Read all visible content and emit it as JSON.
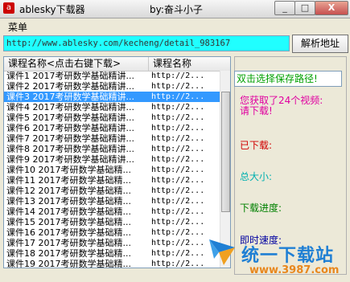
{
  "window": {
    "title": "ablesky下载器",
    "author": "by:奋斗小子",
    "min_glyph": "_",
    "max_glyph": "□",
    "close_glyph": "X"
  },
  "menu": {
    "label": "菜单"
  },
  "url_bar": {
    "value": "http://www.ablesky.com/kecheng/detail_983167",
    "button": "解析地址"
  },
  "list": {
    "columns": [
      "课程名称<点击右键下载>",
      "课程名称"
    ],
    "rows": [
      {
        "name": "课件1 2017考研数学基础精讲...",
        "url": "http://2...",
        "selected": false
      },
      {
        "name": "课件2 2017考研数学基础精讲...",
        "url": "http://2...",
        "selected": false
      },
      {
        "name": "课件3 2017考研数学基础精讲...",
        "url": "http://2...",
        "selected": true
      },
      {
        "name": "课件4 2017考研数学基础精讲...",
        "url": "http://2...",
        "selected": false
      },
      {
        "name": "课件5 2017考研数学基础精讲...",
        "url": "http://2...",
        "selected": false
      },
      {
        "name": "课件6 2017考研数学基础精讲...",
        "url": "http://2...",
        "selected": false
      },
      {
        "name": "课件7 2017考研数学基础精讲...",
        "url": "http://2...",
        "selected": false
      },
      {
        "name": "课件8 2017考研数学基础精讲...",
        "url": "http://2...",
        "selected": false
      },
      {
        "name": "课件9 2017考研数学基础精讲...",
        "url": "http://2...",
        "selected": false
      },
      {
        "name": "课件10 2017考研数学基础精...",
        "url": "http://2...",
        "selected": false
      },
      {
        "name": "课件11 2017考研数学基础精...",
        "url": "http://2...",
        "selected": false
      },
      {
        "name": "课件12 2017考研数学基础精...",
        "url": "http://2...",
        "selected": false
      },
      {
        "name": "课件13 2017考研数学基础精...",
        "url": "http://2...",
        "selected": false
      },
      {
        "name": "课件14 2017考研数学基础精...",
        "url": "http://2...",
        "selected": false
      },
      {
        "name": "课件15 2017考研数学基础精...",
        "url": "http://2...",
        "selected": false
      },
      {
        "name": "课件16 2017考研数学基础精...",
        "url": "http://2...",
        "selected": false
      },
      {
        "name": "课件17 2017考研数学基础精...",
        "url": "http://2...",
        "selected": false
      },
      {
        "name": "课件18 2017考研数学基础精...",
        "url": "http://2...",
        "selected": false
      },
      {
        "name": "课件19 2017考研数学基础精...",
        "url": "http://2...",
        "selected": false
      }
    ]
  },
  "panel": {
    "path_hint": "双击选择保存路径!",
    "video_count_line1": "您获取了24个视频:",
    "video_count_line2": "请下载!",
    "downloaded_label": "已下载:",
    "total_size_label": "总大小:",
    "progress_label": "下载进度:",
    "speed_label": "即时速度:"
  },
  "watermark": {
    "text": "统一下载站",
    "domain": "www.3987.com"
  }
}
